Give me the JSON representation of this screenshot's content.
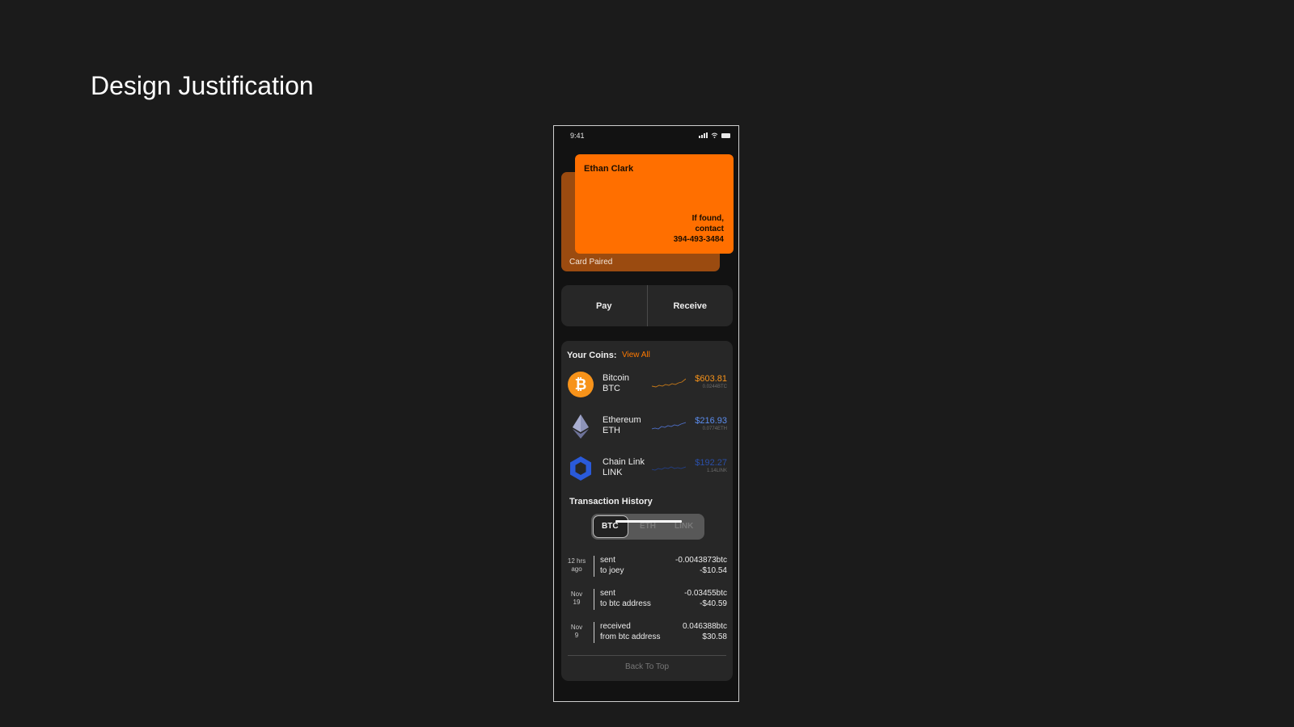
{
  "slide": {
    "title": "Design Justification"
  },
  "status_bar": {
    "time": "9:41",
    "icons": [
      "signal-icon",
      "wifi-icon",
      "battery-icon"
    ]
  },
  "card": {
    "name": "Ethan Clark",
    "contact_lines": [
      "If found,",
      "contact",
      "394-493-3484"
    ],
    "paired_label": "Card Paired",
    "front_color": "#ff6f00",
    "back_color": "#9b4b10"
  },
  "actions": {
    "pay": "Pay",
    "receive": "Receive"
  },
  "coins": {
    "heading": "Your Coins:",
    "view_all": "View All",
    "items": [
      {
        "name": "Bitcoin",
        "symbol": "BTC",
        "price": "$603.81",
        "amount": "0.0244BTC",
        "color": "#f7931a",
        "icon": "bitcoin-icon"
      },
      {
        "name": "Ethereum",
        "symbol": "ETH",
        "price": "$216.93",
        "amount": "0.0774ETH",
        "color": "#5b8def",
        "icon": "ethereum-icon"
      },
      {
        "name": "Chain Link",
        "symbol": "LINK",
        "price": "$192.27",
        "amount": "1.14LINK",
        "color": "#2a5ada",
        "icon": "chainlink-icon"
      }
    ]
  },
  "transactions": {
    "heading": "Transaction History",
    "tabs": [
      "BTC",
      "ETH",
      "LINK"
    ],
    "active_tab": "BTC",
    "items": [
      {
        "date_line1": "12 hrs",
        "date_line2": "ago",
        "type": "sent",
        "party": "to joey",
        "crypto": "-0.0043873btc",
        "usd": "-$10.54"
      },
      {
        "date_line1": "Nov",
        "date_line2": "19",
        "type": "sent",
        "party": "to btc address",
        "crypto": "-0.03455btc",
        "usd": "-$40.59"
      },
      {
        "date_line1": "Nov",
        "date_line2": "9",
        "type": "received",
        "party": "from btc address",
        "crypto": "0.046388btc",
        "usd": "$30.58"
      }
    ],
    "back_to_top": "Back To Top"
  }
}
